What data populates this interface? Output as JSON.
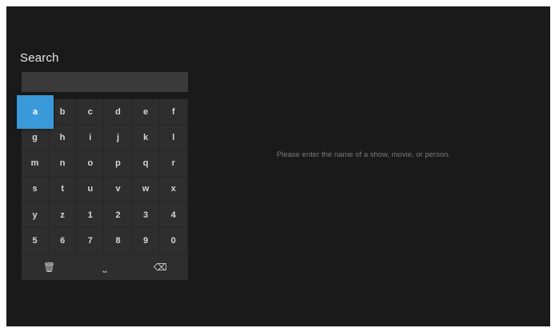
{
  "search": {
    "title": "Search",
    "query": ""
  },
  "keyboard": {
    "rows": [
      [
        "a",
        "b",
        "c",
        "d",
        "e",
        "f"
      ],
      [
        "g",
        "h",
        "i",
        "j",
        "k",
        "l"
      ],
      [
        "m",
        "n",
        "o",
        "p",
        "q",
        "r"
      ],
      [
        "s",
        "t",
        "u",
        "v",
        "w",
        "x"
      ],
      [
        "y",
        "z",
        "1",
        "2",
        "3",
        "4"
      ],
      [
        "5",
        "6",
        "7",
        "8",
        "9",
        "0"
      ]
    ],
    "selected_key": "a",
    "function_keys": [
      {
        "name": "clear-key",
        "icon": "trash-icon",
        "glyph": "🗑"
      },
      {
        "name": "space-key",
        "icon": "space-icon",
        "glyph": "⎵"
      },
      {
        "name": "backspace-key",
        "icon": "backspace-icon",
        "glyph": "⌫"
      }
    ]
  },
  "results": {
    "message": "Please enter the name of a show, movie, or person."
  },
  "colors": {
    "background": "#1a1a1a",
    "keyboard": "#2e2e2e",
    "accent": "#3a9ad9"
  }
}
